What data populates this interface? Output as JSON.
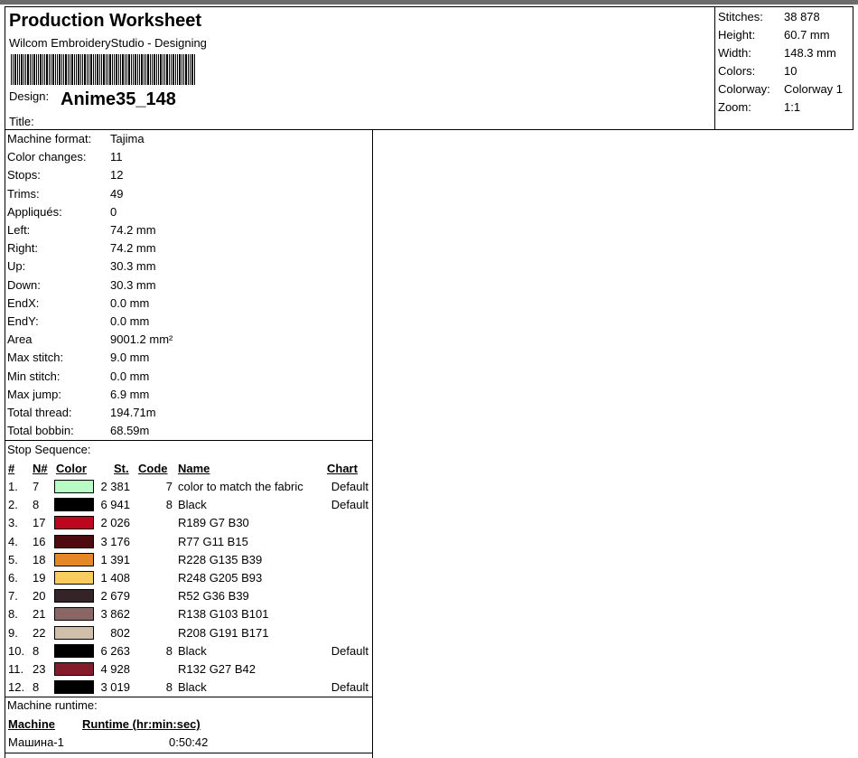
{
  "header": {
    "title": "Production Worksheet",
    "subtitle": "Wilcom EmbroideryStudio - Designing",
    "design_label": "Design:",
    "design_name": "Anime35_148",
    "title_label": "Title:"
  },
  "stats": [
    {
      "label": "Stitches:",
      "value": "38 878"
    },
    {
      "label": "Height:",
      "value": "60.7 mm"
    },
    {
      "label": "Width:",
      "value": "148.3 mm"
    },
    {
      "label": "Colors:",
      "value": "10"
    },
    {
      "label": "Colorway:",
      "value": "Colorway 1"
    },
    {
      "label": "Zoom:",
      "value": "1:1"
    }
  ],
  "info": [
    {
      "label": "Machine format:",
      "value": "Tajima"
    },
    {
      "label": "Color changes:",
      "value": "11"
    },
    {
      "label": "Stops:",
      "value": "12"
    },
    {
      "label": "Trims:",
      "value": "49"
    },
    {
      "label": "Appliqués:",
      "value": "0"
    },
    {
      "label": "Left:",
      "value": "74.2 mm"
    },
    {
      "label": "Right:",
      "value": "74.2 mm"
    },
    {
      "label": "Up:",
      "value": "30.3 mm"
    },
    {
      "label": "Down:",
      "value": "30.3 mm"
    },
    {
      "label": "EndX:",
      "value": "0.0 mm"
    },
    {
      "label": "EndY:",
      "value": "0.0 mm"
    },
    {
      "label": "Area",
      "value": "9001.2 mm²"
    },
    {
      "label": "Max stitch:",
      "value": "9.0 mm"
    },
    {
      "label": "Min stitch:",
      "value": "0.0 mm"
    },
    {
      "label": "Max jump:",
      "value": "6.9 mm"
    },
    {
      "label": "Total thread:",
      "value": "194.71m"
    },
    {
      "label": "Total bobbin:",
      "value": "68.59m"
    }
  ],
  "stop_sequence": {
    "label": "Stop Sequence:",
    "headers": {
      "num": "#",
      "n": "N#",
      "color": "Color",
      "st": "St.",
      "code": "Code",
      "name": "Name",
      "chart": "Chart"
    },
    "rows": [
      {
        "num": "1.",
        "n": "7",
        "color": "#b9fbc4",
        "st": "2 381",
        "code": "7",
        "name": "color to match the fabric",
        "chart": "Default"
      },
      {
        "num": "2.",
        "n": "8",
        "color": "#000000",
        "st": "6 941",
        "code": "8",
        "name": "Black",
        "chart": "Default"
      },
      {
        "num": "3.",
        "n": "17",
        "color": "#bd071e",
        "st": "2 026",
        "code": "",
        "name": "R189 G7 B30",
        "chart": ""
      },
      {
        "num": "4.",
        "n": "16",
        "color": "#4d0b0f",
        "st": "3 176",
        "code": "",
        "name": "R77 G11 B15",
        "chart": ""
      },
      {
        "num": "5.",
        "n": "18",
        "color": "#e48727",
        "st": "1 391",
        "code": "",
        "name": "R228 G135 B39",
        "chart": ""
      },
      {
        "num": "6.",
        "n": "19",
        "color": "#f8cd5d",
        "st": "1 408",
        "code": "",
        "name": "R248 G205 B93",
        "chart": ""
      },
      {
        "num": "7.",
        "n": "20",
        "color": "#342427",
        "st": "2 679",
        "code": "",
        "name": "R52 G36 B39",
        "chart": ""
      },
      {
        "num": "8.",
        "n": "21",
        "color": "#8a6765",
        "st": "3 862",
        "code": "",
        "name": "R138 G103 B101",
        "chart": ""
      },
      {
        "num": "9.",
        "n": "22",
        "color": "#d0bfab",
        "st": "802",
        "code": "",
        "name": "R208 G191 B171",
        "chart": ""
      },
      {
        "num": "10.",
        "n": "8",
        "color": "#000000",
        "st": "6 263",
        "code": "8",
        "name": "Black",
        "chart": "Default"
      },
      {
        "num": "11.",
        "n": "23",
        "color": "#841b2a",
        "st": "4 928",
        "code": "",
        "name": "R132 G27 B42",
        "chart": ""
      },
      {
        "num": "12.",
        "n": "8",
        "color": "#000000",
        "st": "3 019",
        "code": "8",
        "name": "Black",
        "chart": "Default"
      }
    ]
  },
  "runtime": {
    "label": "Machine runtime:",
    "col_machine": "Machine",
    "col_runtime": "Runtime (hr:min:sec)",
    "machine": "Машина-1",
    "time": "0:50:42"
  }
}
